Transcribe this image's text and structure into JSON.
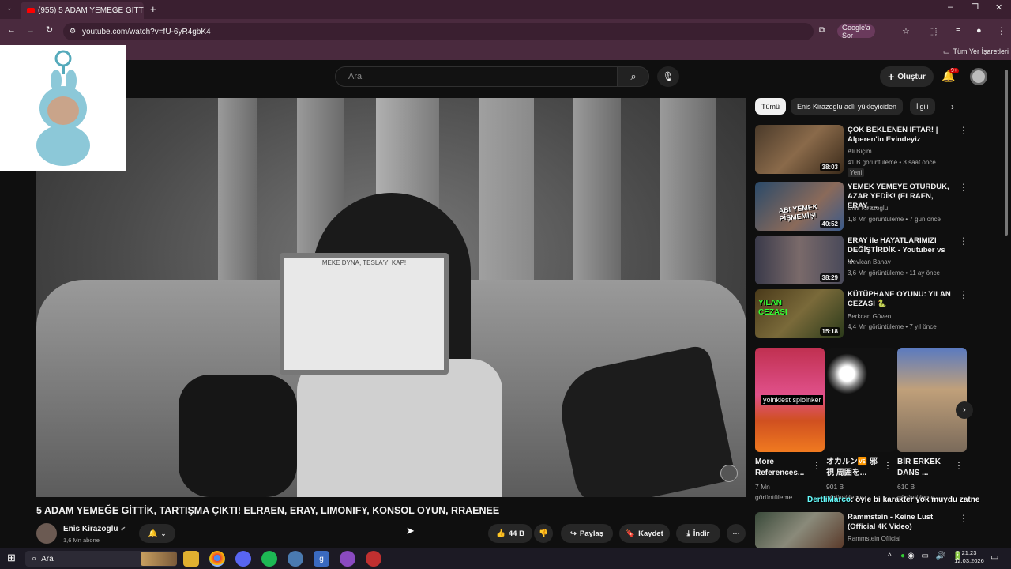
{
  "browser": {
    "tab_title": "(955) 5 ADAM YEMEĞE GİTT",
    "url": "youtube.com/watch?v=fU-6yR4gbK4",
    "google_ask": "Google'a Sor",
    "bookmarks_label": "Tüm Yer İşaretleri"
  },
  "yt": {
    "search_placeholder": "Ara",
    "create_label": "Oluştur",
    "notif_badge": "9+"
  },
  "video": {
    "title": "5 ADAM YEMEĞE GİTTİK, TARTIŞMA ÇIKTI! ELRAEN, ERAY, LIMONIFY, KONSOL OYUN, RRAENEE",
    "channel": "Enis Kirazoglu",
    "subscribers": "1,6 Mn abone",
    "likes": "44 B",
    "share": "Paylaş",
    "save": "Kaydet",
    "download": "İndir",
    "card_text": "MEKE DYNA, TESLA'YI KAP!"
  },
  "chips": [
    "Tümü",
    "Enis Kirazoglu adlı yükleyiciden",
    "İlgili"
  ],
  "recommended": [
    {
      "title": "ÇOK BEKLENEN İFTAR! | Alperen'in Evindeyiz",
      "channel": "Ali Biçim",
      "meta": "41 B görüntüleme • 3 saat önce",
      "badge": "Yeni",
      "duration": "38:03"
    },
    {
      "title": "YEMEK YEMEYE OTURDUK, AZAR YEDİK! (ELRAEN, ERAY, ...",
      "channel": "Enis Kirazoglu",
      "meta": "1,8 Mn görüntüleme • 7 gün önce",
      "duration": "40:52",
      "thumb_text": "ABI YEMEK PİŞMEMİŞ!"
    },
    {
      "title": "ERAY ile HAYATLARIMIZI DEĞİŞTİRDİK - Youtuber vs ...",
      "channel": "Mevlcan Bahav",
      "meta": "3,6 Mn görüntüleme • 11 ay önce",
      "duration": "38:29"
    },
    {
      "title": "KÜTÜPHANE OYUNU: YILAN CEZASI 🐍",
      "channel": "Berkcan Güven",
      "meta": "4,4 Mn görüntüleme • 7 yıl önce",
      "duration": "15:18",
      "thumb_text": "YILAN CEZASI"
    }
  ],
  "shorts": [
    {
      "title": "More References...",
      "views": "7 Mn",
      "meta": "görüntüleme",
      "thumb_text": "yoinkiest sploinker"
    },
    {
      "title": "オカルン🆚 邪視 周囲を...",
      "views": "901 B",
      "meta": "görüntüleme"
    },
    {
      "title": "BİR ERKEK DANS ...",
      "views": "610 B",
      "meta": "görüntüleme"
    }
  ],
  "chat_overlay": {
    "user": "DertliMarco",
    "message": ": öyle bi karakter yok muydu zatne"
  },
  "last_rec": {
    "title": "Rammstein - Keine Lust (Official 4K Video)",
    "channel": "Rammstein Official"
  },
  "taskbar": {
    "search": "Ara",
    "time": "21:23",
    "date": "12.03.2026"
  }
}
